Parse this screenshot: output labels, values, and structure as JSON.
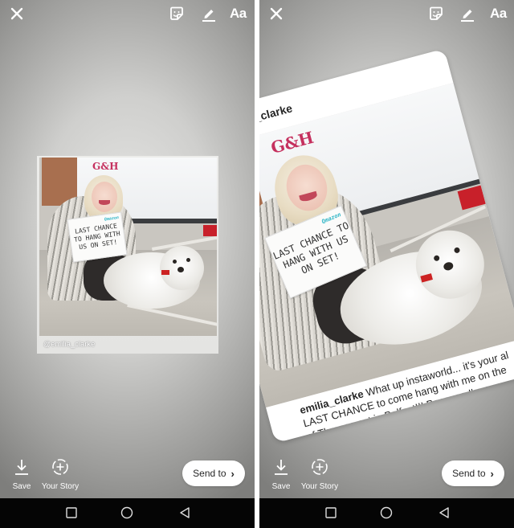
{
  "screens": [
    {
      "id": "left",
      "toolbar": {
        "close_icon": "close-icon",
        "sticker_icon": "sticker-icon",
        "draw_icon": "pen-icon",
        "text_label": "Aa"
      },
      "content": {
        "type": "shared-post-image",
        "sign_tag": "Qmazon",
        "sign_text": "LAST CHANCE TO HANG WITH US ON SET!",
        "logo_text": "G&H",
        "watermark": "@emilia_clarke"
      },
      "actions": {
        "save_label": "Save",
        "your_story_label": "Your Story",
        "send_label": "Send to",
        "send_chevron": "›"
      }
    },
    {
      "id": "right",
      "toolbar": {
        "close_icon": "close-icon",
        "sticker_icon": "sticker-icon",
        "draw_icon": "pen-icon",
        "text_label": "Aa"
      },
      "content": {
        "type": "shared-post-card",
        "username": "emilia_clarke",
        "sign_tag": "Qmazon",
        "sign_text": "LAST CHANCE TO HANG WITH US ON SET!",
        "logo_text": "G&H",
        "caption_user": "emilia_clarke",
        "caption_line1": " What up instaworld... it's your al",
        "caption_line2": "LAST CHANCE to come hang with me on the",
        "caption_line3": "of Thrones set in Belfast!!! Because I'm suc"
      },
      "actions": {
        "save_label": "Save",
        "your_story_label": "Your Story",
        "send_label": "Send to",
        "send_chevron": "›"
      }
    }
  ],
  "navbar": {
    "buttons": [
      "recent-apps",
      "home",
      "back"
    ]
  },
  "colors": {
    "nav_bar": "#050505",
    "divider": "#ffffff",
    "send_button_bg": "#ffffff",
    "brand_logo": "#c5305e",
    "sign_tag": "#2fb6c7"
  }
}
